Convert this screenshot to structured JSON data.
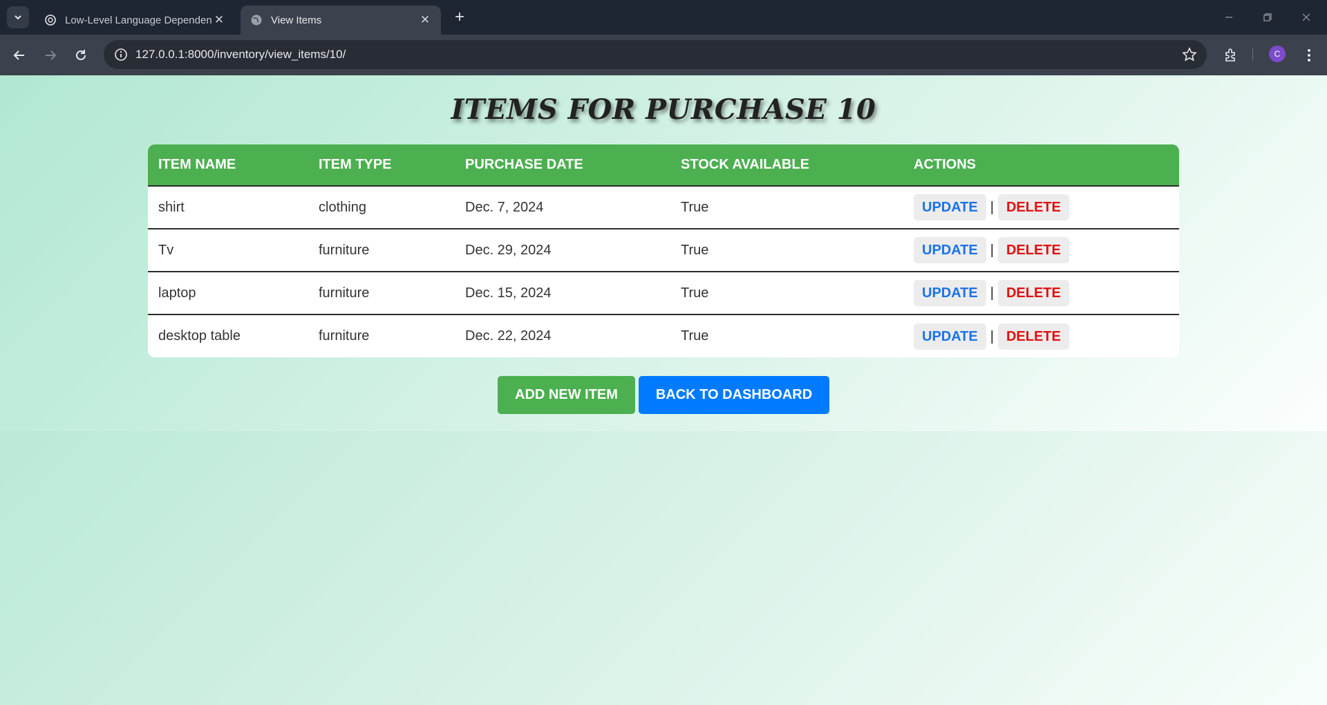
{
  "browser": {
    "tabs": [
      {
        "title": "Low-Level Language Dependen",
        "active": false,
        "favicon": "openai-icon"
      },
      {
        "title": "View Items",
        "active": true,
        "favicon": "globe-icon"
      }
    ],
    "new_tab_label": "+",
    "close_label": "✕",
    "url": "127.0.0.1:8000/inventory/view_items/10/",
    "profile_initial": "C"
  },
  "page": {
    "heading": "ITEMS FOR PURCHASE 10",
    "table": {
      "headers": [
        "ITEM NAME",
        "ITEM TYPE",
        "PURCHASE DATE",
        "STOCK AVAILABLE",
        "ACTIONS"
      ],
      "rows": [
        {
          "name": "shirt",
          "type": "clothing",
          "date": "Dec. 7, 2024",
          "stock": "True"
        },
        {
          "name": "Tv",
          "type": "furniture",
          "date": "Dec. 29, 2024",
          "stock": "True"
        },
        {
          "name": "laptop",
          "type": "furniture",
          "date": "Dec. 15, 2024",
          "stock": "True"
        },
        {
          "name": "desktop table",
          "type": "furniture",
          "date": "Dec. 22, 2024",
          "stock": "True"
        }
      ],
      "update_label": "UPDATE",
      "delete_label": "DELETE",
      "separator": "|"
    },
    "add_button": "ADD NEW ITEM",
    "back_button": "BACK TO DASHBOARD"
  },
  "colors": {
    "header_green": "#4caf50",
    "add_button_green": "#4caf50",
    "back_button_blue": "#007bff",
    "update_blue": "#1a73e8",
    "delete_red": "#e0100f"
  }
}
